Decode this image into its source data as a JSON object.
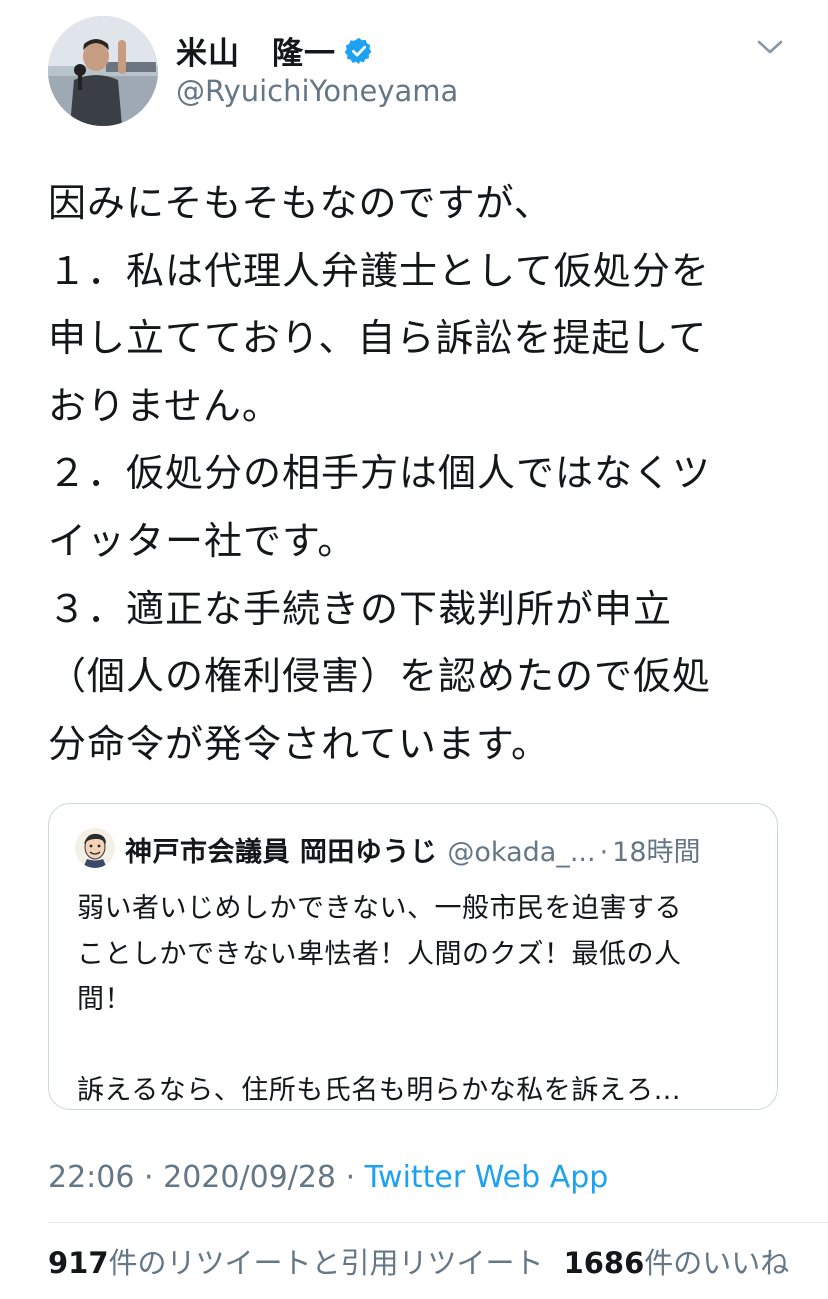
{
  "author": {
    "display_name": "米山　隆一",
    "handle": "@RyuichiYoneyama",
    "verified": true
  },
  "menu_icon": "chevron-down-icon",
  "tweet": {
    "lines": [
      "因みにそもそもなのですが、",
      "１．私は代理人弁護士として仮処分を",
      "申し立てており、自ら訴訟を提起して",
      "おりません。",
      "２．仮処分の相手方は個人ではなくツ",
      "イッター社です。",
      "３．適正な手続きの下裁判所が申立",
      "（個人の権利侵害）を認めたので仮処",
      "分命令が発令されています。"
    ]
  },
  "quoted_tweet": {
    "display_name": "神戸市会議員 岡田ゆうじ",
    "handle": "@okada_...",
    "separator": "·",
    "time": "18時間",
    "lines": [
      "弱い者いじめしかできない、一般市民を迫害する",
      "ことしかできない卑怯者！人間のクズ！最低の人",
      "間！",
      "",
      "訴えるなら、住所も氏名も明らかな私を訴えろ..."
    ]
  },
  "meta": {
    "time": "22:06",
    "dot": "·",
    "date": "2020/09/28",
    "source": "Twitter Web App"
  },
  "stats": {
    "retweets_count": "917",
    "retweets_label": "件のリツイートと引用リツイート",
    "likes_count": "1686",
    "likes_label": "件のいいね"
  },
  "colors": {
    "text": "#14171a",
    "secondary": "#657786",
    "link": "#1da1f2",
    "verified": "#1da1f2",
    "border": "#ccd6dd"
  }
}
